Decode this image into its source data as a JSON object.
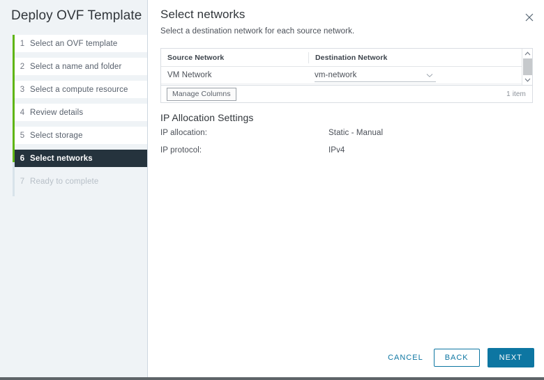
{
  "sidebar": {
    "title": "Deploy OVF Template",
    "steps": [
      {
        "num": "1",
        "label": "Select an OVF template",
        "state": "done"
      },
      {
        "num": "2",
        "label": "Select a name and folder",
        "state": "done"
      },
      {
        "num": "3",
        "label": "Select a compute resource",
        "state": "done"
      },
      {
        "num": "4",
        "label": "Review details",
        "state": "done"
      },
      {
        "num": "5",
        "label": "Select storage",
        "state": "done"
      },
      {
        "num": "6",
        "label": "Select networks",
        "state": "active"
      },
      {
        "num": "7",
        "label": "Ready to complete",
        "state": "disabled"
      }
    ]
  },
  "main": {
    "title": "Select networks",
    "subtitle": "Select a destination network for each source network.",
    "close_icon": "close-icon"
  },
  "table": {
    "columns": [
      "Source Network",
      "Destination Network"
    ],
    "rows": [
      {
        "source": "VM Network",
        "destination": "vm-network"
      }
    ],
    "destination_chevron_icon": "chevron-down-icon",
    "scrollbar": {
      "up_icon": "chevron-up-icon",
      "down_icon": "chevron-down-icon"
    },
    "footer": {
      "manage_columns_label": "Manage Columns",
      "item_count": "1 item"
    }
  },
  "ip_allocation": {
    "section_title": "IP Allocation Settings",
    "rows": [
      {
        "label": "IP allocation:",
        "value": "Static - Manual"
      },
      {
        "label": "IP protocol:",
        "value": "IPv4"
      }
    ]
  },
  "footer_buttons": {
    "cancel": "CANCEL",
    "back": "BACK",
    "next": "NEXT"
  },
  "colors": {
    "accent": "#0d76a2",
    "progress_green": "#60b515",
    "active_step_bg": "#25333d",
    "sidebar_bg": "#eff3f6"
  }
}
